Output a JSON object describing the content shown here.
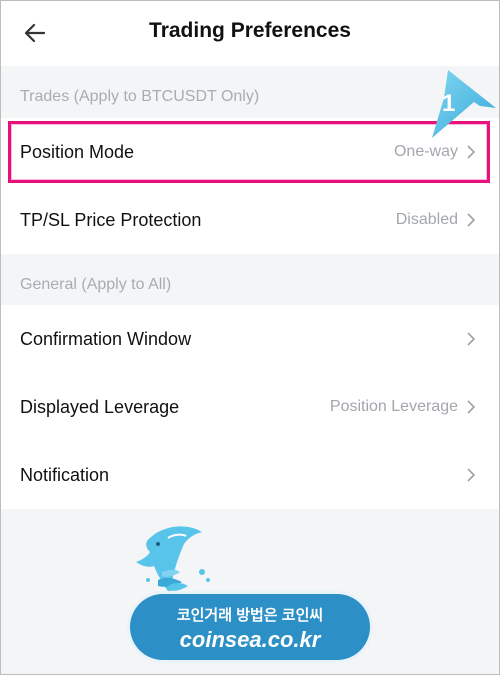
{
  "header": {
    "title": "Trading Preferences",
    "back_icon": "arrow-left-icon"
  },
  "sections": [
    {
      "label": "Trades (Apply to BTCUSDT Only)",
      "rows": [
        {
          "label": "Position Mode",
          "value": "One-way"
        },
        {
          "label": "TP/SL Price Protection",
          "value": "Disabled"
        }
      ]
    },
    {
      "label": "General (Apply to All)",
      "rows": [
        {
          "label": "Confirmation Window",
          "value": ""
        },
        {
          "label": "Displayed Leverage",
          "value": "Position Leverage"
        },
        {
          "label": "Notification",
          "value": ""
        }
      ]
    }
  ],
  "annotation": {
    "step_number": "1"
  },
  "watermark": {
    "korean_text": "코인거래 방법은 코인씨",
    "url": "coinsea.co.kr"
  },
  "colors": {
    "highlight": "#e8127d",
    "annotation": "#4fc3e8",
    "badge": "#2c8fc6"
  }
}
